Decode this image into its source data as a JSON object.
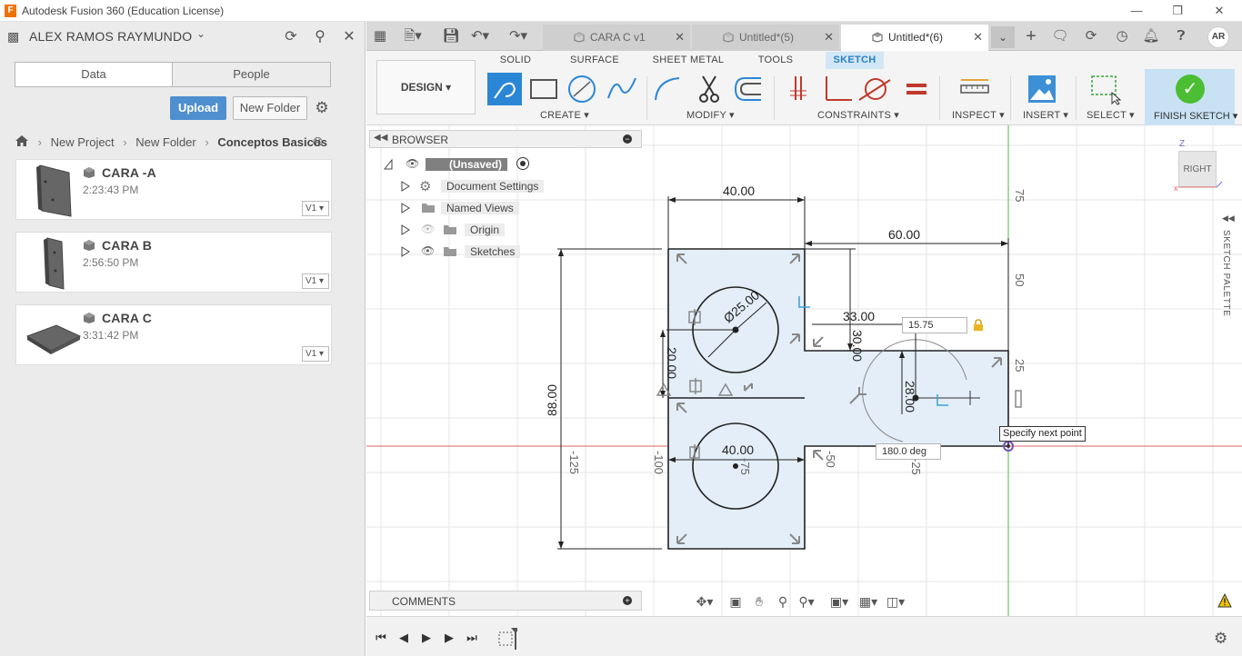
{
  "window": {
    "title": "Autodesk Fusion 360 (Education License)",
    "logo": "F"
  },
  "data_panel": {
    "user_name": "ALEX RAMOS RAYMUNDO",
    "tabs": [
      "Data",
      "People"
    ],
    "upload_label": "Upload",
    "new_folder_label": "New Folder",
    "breadcrumb": [
      "New Project",
      "New Folder",
      "Conceptos Basicos"
    ],
    "files": [
      {
        "name": "CARA -A",
        "time": "2:23:43 PM",
        "version": "V1"
      },
      {
        "name": "CARA B",
        "time": "2:56:50 PM",
        "version": "V1"
      },
      {
        "name": "CARA C",
        "time": "3:31:42 PM",
        "version": "V1"
      }
    ]
  },
  "doc_tabs": [
    {
      "label": "CARA C v1",
      "active": false
    },
    {
      "label": "Untitled*(5)",
      "active": false
    },
    {
      "label": "Untitled*(6)",
      "active": true
    }
  ],
  "user_initials": "AR",
  "ribbon": {
    "workspace": "DESIGN",
    "tabs": [
      "SOLID",
      "SURFACE",
      "SHEET METAL",
      "TOOLS",
      "SKETCH"
    ],
    "active_tab": "SKETCH",
    "groups": [
      "CREATE ▾",
      "MODIFY ▾",
      "CONSTRAINTS ▾",
      "INSPECT ▾",
      "INSERT ▾",
      "SELECT ▾"
    ],
    "finish_label": "FINISH SKETCH ▾"
  },
  "browser": {
    "title": "BROWSER",
    "root": "(Unsaved)",
    "items": [
      "Document Settings",
      "Named Views",
      "Origin",
      "Sketches"
    ]
  },
  "comments_title": "COMMENTS",
  "viewcube_label": "RIGHT",
  "axis_label": "Z",
  "sketch_palette_label": "SKETCH PALETTE",
  "sketch": {
    "dimensions": [
      "40.00",
      "60.00",
      "33.00",
      "30.00",
      "Ø25.00",
      "20.00",
      "88.00",
      "28.00",
      "40.00"
    ],
    "ruler_v": [
      "75",
      "50",
      "25"
    ],
    "ruler_h": [
      "-125",
      "-100",
      "-75",
      "-50",
      "-25"
    ],
    "input_value": "15.75",
    "angle_value": "180.0 deg",
    "tooltip": "Specify next point"
  }
}
